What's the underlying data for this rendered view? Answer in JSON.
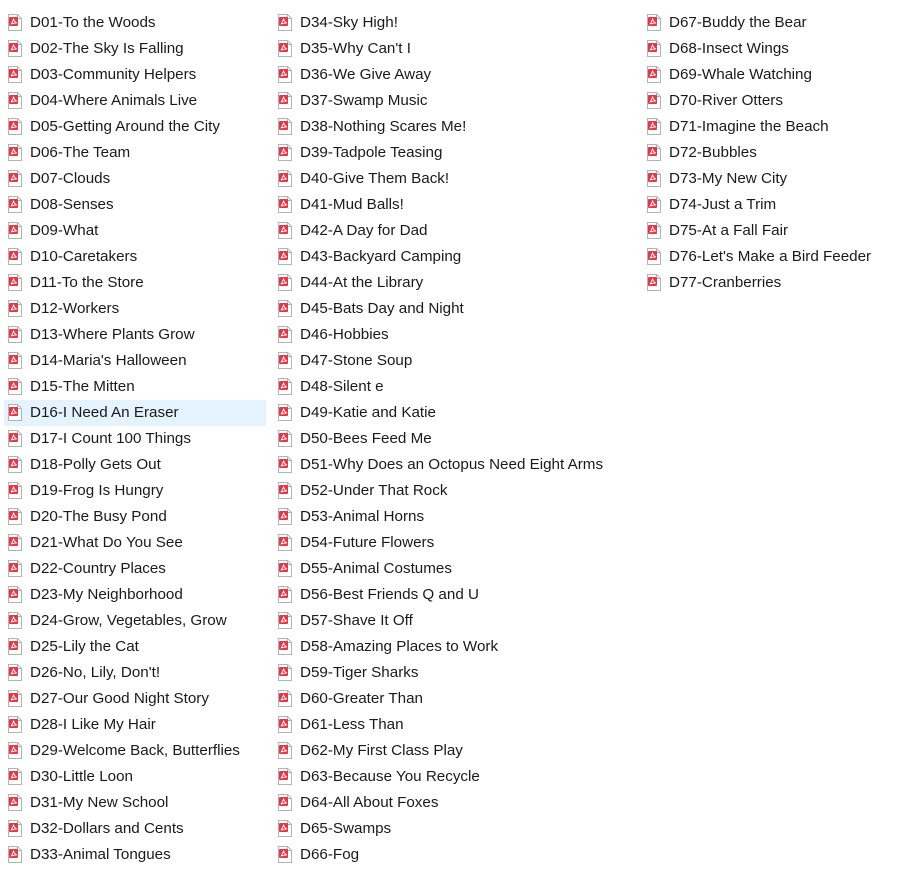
{
  "colors": {
    "selection_background": "#e5f3ff",
    "icon_accent": "#e0394a",
    "icon_paper": "#ffffff",
    "icon_border": "#b3b3b3"
  },
  "icon": "pdf-file-icon",
  "selected_item": "D16-I Need An Eraser",
  "columns": [
    {
      "items": [
        "D01-To the Woods",
        "D02-The Sky Is Falling",
        "D03-Community Helpers",
        "D04-Where Animals Live",
        "D05-Getting Around the City",
        "D06-The Team",
        "D07-Clouds",
        "D08-Senses",
        "D09-What",
        "D10-Caretakers",
        "D11-To the Store",
        "D12-Workers",
        "D13-Where Plants Grow",
        "D14-Maria's Halloween",
        "D15-The Mitten",
        "D16-I Need An Eraser",
        "D17-I Count 100 Things",
        "D18-Polly Gets Out",
        "D19-Frog Is Hungry",
        "D20-The Busy Pond",
        "D21-What Do You See",
        "D22-Country Places",
        "D23-My Neighborhood",
        "D24-Grow, Vegetables, Grow",
        "D25-Lily the Cat",
        "D26-No, Lily, Don't!",
        "D27-Our Good Night Story",
        "D28-I Like My Hair",
        "D29-Welcome Back, Butterflies",
        "D30-Little Loon",
        "D31-My New School",
        "D32-Dollars and Cents",
        "D33-Animal Tongues"
      ]
    },
    {
      "items": [
        "D34-Sky High!",
        "D35-Why Can't I",
        "D36-We Give Away",
        "D37-Swamp Music",
        "D38-Nothing Scares Me!",
        "D39-Tadpole Teasing",
        "D40-Give Them Back!",
        "D41-Mud Balls!",
        "D42-A Day for Dad",
        "D43-Backyard Camping",
        "D44-At the Library",
        "D45-Bats Day and Night",
        "D46-Hobbies",
        "D47-Stone Soup",
        "D48-Silent e",
        "D49-Katie and Katie",
        "D50-Bees Feed Me",
        "D51-Why Does an Octopus Need Eight Arms",
        "D52-Under That Rock",
        "D53-Animal Horns",
        "D54-Future Flowers",
        "D55-Animal Costumes",
        "D56-Best Friends Q and U",
        "D57-Shave It Off",
        "D58-Amazing Places to Work",
        "D59-Tiger Sharks",
        "D60-Greater Than",
        "D61-Less Than",
        "D62-My First Class Play",
        "D63-Because You Recycle",
        "D64-All About Foxes",
        "D65-Swamps",
        "D66-Fog"
      ]
    },
    {
      "items": [
        "D67-Buddy the Bear",
        "D68-Insect Wings",
        "D69-Whale Watching",
        "D70-River Otters",
        "D71-Imagine the Beach",
        "D72-Bubbles",
        "D73-My New City",
        "D74-Just a Trim",
        "D75-At a Fall Fair",
        "D76-Let's Make a Bird Feeder",
        "D77-Cranberries"
      ]
    }
  ]
}
